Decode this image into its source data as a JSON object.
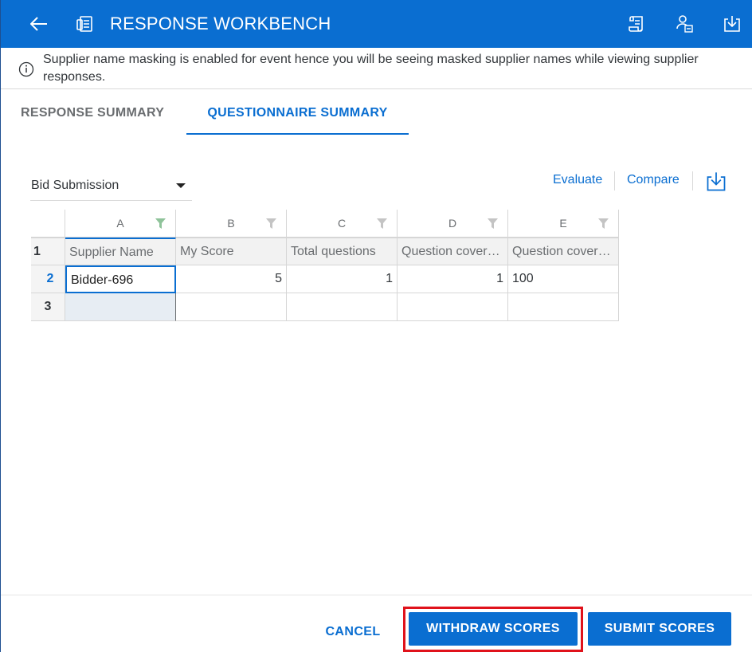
{
  "header": {
    "title": "RESPONSE WORKBENCH",
    "back_icon": "arrow-left-icon",
    "doc_icon": "document-icon",
    "actions": [
      "scroll-icon",
      "user-hierarchy-icon",
      "download-icon"
    ]
  },
  "banner": {
    "text": "Supplier name masking is enabled for event hence you will be seeing masked supplier names while viewing supplier responses.",
    "icon": "info-icon"
  },
  "tabs": [
    {
      "label": "RESPONSE SUMMARY",
      "active": false
    },
    {
      "label": "QUESTIONNAIRE SUMMARY",
      "active": true
    }
  ],
  "select": {
    "value": "Bid Submission"
  },
  "actions": {
    "evaluate": "Evaluate",
    "compare": "Compare",
    "download_icon": "download-icon"
  },
  "grid": {
    "column_letters": [
      "A",
      "B",
      "C",
      "D",
      "E"
    ],
    "row_numbers": [
      "1",
      "2",
      "3"
    ],
    "headers": [
      "Supplier Name",
      "My Score",
      "Total questions",
      "Question cover…",
      "Question cover…"
    ],
    "rows": [
      [
        "Bidder-696",
        "5",
        "1",
        "1",
        "100"
      ],
      [
        "",
        "",
        "",
        "",
        ""
      ]
    ]
  },
  "footer": {
    "cancel": "CANCEL",
    "withdraw": "WITHDRAW SCORES",
    "submit": "SUBMIT SCORES"
  },
  "colors": {
    "brand": "#0a6ed1",
    "highlight": "#e0121b"
  }
}
